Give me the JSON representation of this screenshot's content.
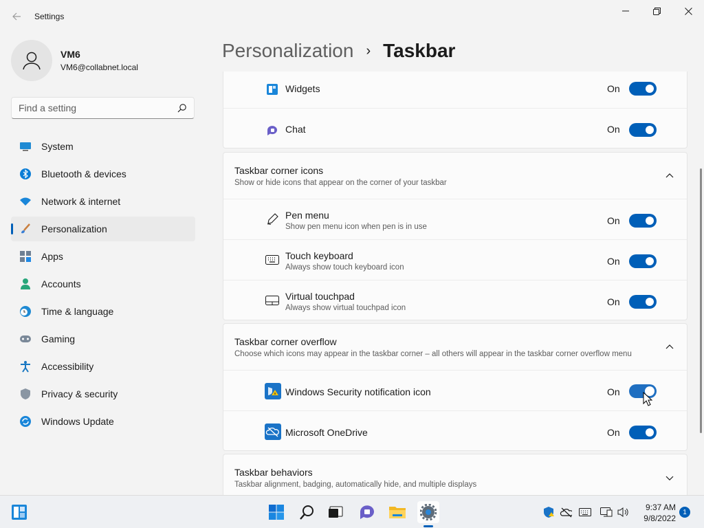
{
  "window": {
    "title": "Settings"
  },
  "profile": {
    "name": "VM6",
    "email": "VM6@collabnet.local"
  },
  "search": {
    "placeholder": "Find a setting"
  },
  "sidebar": {
    "items": [
      {
        "label": "System",
        "icon": "system-icon"
      },
      {
        "label": "Bluetooth & devices",
        "icon": "bluetooth-icon"
      },
      {
        "label": "Network & internet",
        "icon": "wifi-icon"
      },
      {
        "label": "Personalization",
        "icon": "brush-icon",
        "active": true
      },
      {
        "label": "Apps",
        "icon": "apps-icon"
      },
      {
        "label": "Accounts",
        "icon": "accounts-icon"
      },
      {
        "label": "Time & language",
        "icon": "clock-globe-icon"
      },
      {
        "label": "Gaming",
        "icon": "gamepad-icon"
      },
      {
        "label": "Accessibility",
        "icon": "accessibility-icon"
      },
      {
        "label": "Privacy & security",
        "icon": "shield-icon"
      },
      {
        "label": "Windows Update",
        "icon": "update-icon"
      }
    ]
  },
  "breadcrumb": {
    "parent": "Personalization",
    "separator": "›",
    "current": "Taskbar"
  },
  "taskbar_items": {
    "rows": [
      {
        "title": "Widgets",
        "state": "On",
        "icon": "widgets-icon"
      },
      {
        "title": "Chat",
        "state": "On",
        "icon": "chat-icon"
      }
    ]
  },
  "corner_icons": {
    "title": "Taskbar corner icons",
    "subtitle": "Show or hide icons that appear on the corner of your taskbar",
    "rows": [
      {
        "title": "Pen menu",
        "subtitle": "Show pen menu icon when pen is in use",
        "state": "On",
        "icon": "pen-icon"
      },
      {
        "title": "Touch keyboard",
        "subtitle": "Always show touch keyboard icon",
        "state": "On",
        "icon": "keyboard-icon"
      },
      {
        "title": "Virtual touchpad",
        "subtitle": "Always show virtual touchpad icon",
        "state": "On",
        "icon": "touchpad-icon"
      }
    ]
  },
  "corner_overflow": {
    "title": "Taskbar corner overflow",
    "subtitle": "Choose which icons may appear in the taskbar corner – all others will appear in the taskbar corner overflow menu",
    "rows": [
      {
        "title": "Windows Security notification icon",
        "state": "On",
        "icon": "windows-security-icon"
      },
      {
        "title": "Microsoft OneDrive",
        "state": "On",
        "icon": "onedrive-icon"
      }
    ]
  },
  "behaviors": {
    "title": "Taskbar behaviors",
    "subtitle": "Taskbar alignment, badging, automatically hide, and multiple displays"
  },
  "system_taskbar": {
    "apps": [
      "widgets-icon",
      "start-icon",
      "search-icon",
      "task-view-icon",
      "chat-icon",
      "file-explorer-icon",
      "settings-icon"
    ],
    "tray": [
      "security-tray-icon",
      "onedrive-tray-icon",
      "keyboard-tray-icon",
      "network-icon",
      "volume-icon"
    ],
    "time": "9:37 AM",
    "date": "9/8/2022",
    "notifications": "1"
  },
  "colors": {
    "accent": "#005fb8",
    "background": "#f3f3f3",
    "card": "#fbfbfb"
  }
}
